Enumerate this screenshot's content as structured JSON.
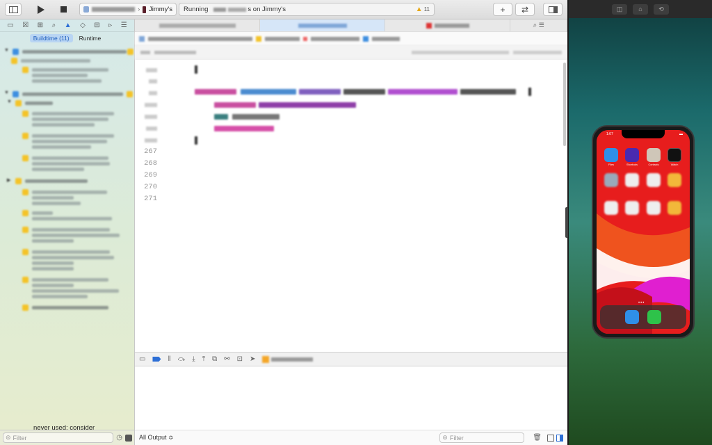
{
  "toolbar": {
    "device_label": "Jimmy's",
    "status_prefix": "Running",
    "status_suffix": "s on Jimmy's",
    "warning_count": "11",
    "add_label": "+",
    "swap_label": "⇄"
  },
  "navigator": {
    "segments": [
      {
        "label": "Buildtime (11)",
        "active": true
      },
      {
        "label": "Runtime",
        "active": false
      }
    ],
    "filter_placeholder": "Filter",
    "tooltip_text": "never used; consider"
  },
  "editor": {
    "line_numbers": [
      "267",
      "268",
      "269",
      "270",
      "271"
    ]
  },
  "console": {
    "output_selector": "All Output ≎",
    "filter_placeholder": "Filter"
  },
  "simulator": {
    "time": "1:07",
    "apps": [
      {
        "name": "Files",
        "color": "#2f8fe8"
      },
      {
        "name": "Shortcuts",
        "color": "#4a2ab0"
      },
      {
        "name": "Contacts",
        "color": "#cfc6b8"
      },
      {
        "name": "Watch",
        "color": "#111111"
      }
    ],
    "accent_color": "#e71d1d"
  }
}
